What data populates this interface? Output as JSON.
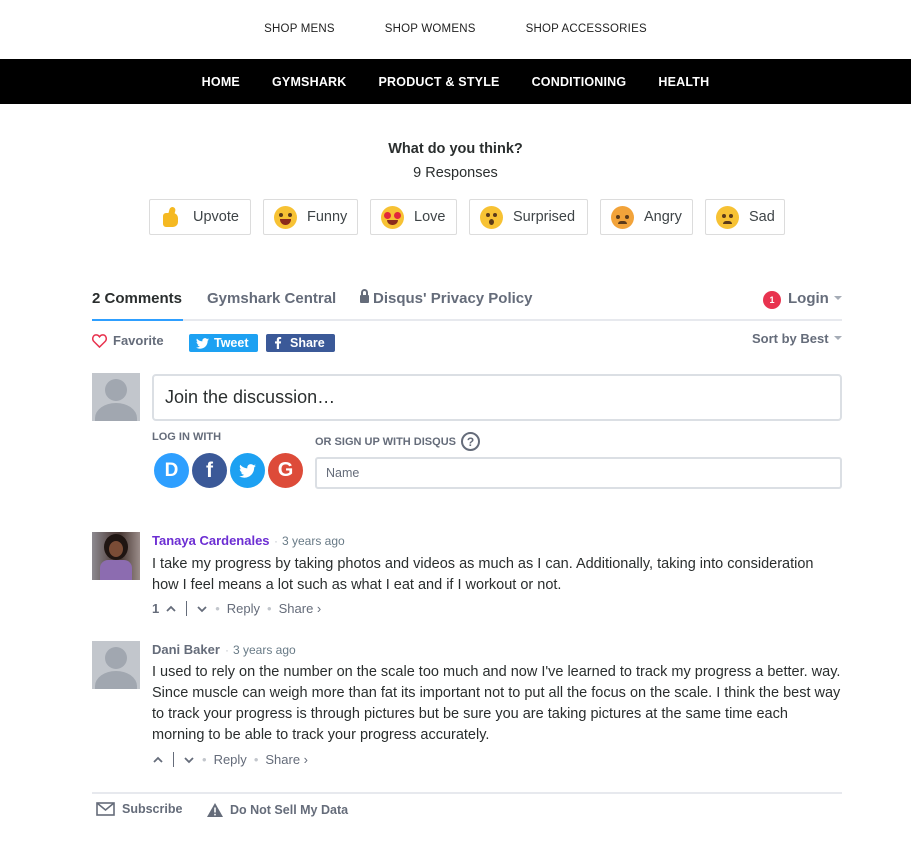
{
  "shop_nav": {
    "items": [
      {
        "label": "SHOP MENS"
      },
      {
        "label": "SHOP WOMENS"
      },
      {
        "label": "SHOP ACCESSORIES"
      }
    ]
  },
  "main_nav": {
    "items": [
      {
        "label": "HOME"
      },
      {
        "label": "GYMSHARK"
      },
      {
        "label": "PRODUCT & STYLE"
      },
      {
        "label": "CONDITIONING"
      },
      {
        "label": "HEALTH"
      }
    ]
  },
  "reactions": {
    "title": "What do you think?",
    "count_label": "9 Responses",
    "items": [
      {
        "label": "Upvote",
        "icon": "thumbs-up-icon"
      },
      {
        "label": "Funny",
        "icon": "laughing-face-icon"
      },
      {
        "label": "Love",
        "icon": "heart-eyes-face-icon"
      },
      {
        "label": "Surprised",
        "icon": "surprised-face-icon"
      },
      {
        "label": "Angry",
        "icon": "angry-face-icon"
      },
      {
        "label": "Sad",
        "icon": "sad-face-icon"
      }
    ]
  },
  "disqus": {
    "tabs": {
      "comments": "2 Comments",
      "community": "Gymshark Central",
      "privacy": "Disqus' Privacy Policy"
    },
    "notification_count": "1",
    "login_label": "Login",
    "favorite_label": "Favorite",
    "tweet_label": "Tweet",
    "share_label": "Share",
    "sort_label": "Sort by Best",
    "join_placeholder": "Join the discussion…",
    "log_in_with": "LOG IN WITH",
    "or_sign_up": "OR SIGN UP WITH DISQUS",
    "help_glyph": "?",
    "name_placeholder": "Name",
    "social_logins": [
      {
        "glyph": "D",
        "color": "#2e9fff",
        "icon": "disqus-icon"
      },
      {
        "glyph": "f",
        "color": "#3b5998",
        "icon": "facebook-icon"
      },
      {
        "glyph": "t",
        "color": "#1da1f2",
        "icon": "twitter-icon"
      },
      {
        "glyph": "G",
        "color": "#dd4b39",
        "icon": "google-icon"
      }
    ],
    "comments": [
      {
        "author": "Tanaya Cardenales",
        "author_color": "#6c2ed3",
        "time": "3 years ago",
        "text": "I take my progress by taking photos and videos as much as I can. Additionally, taking into consideration how I feel means a lot such as what I eat and if I workout or not.",
        "votes": "1",
        "reply": "Reply",
        "share": "Share ›"
      },
      {
        "author": "Dani Baker",
        "author_color": "#656c7a",
        "time": "3 years ago",
        "text": "I used to rely on the number on the scale too much and now I've learned to track my progress a better. way. Since muscle can weigh more than fat its important not to put all the focus on the scale. I think the best way to track your progress is through pictures but be sure you are taking pictures at the same time each morning to be able to track your progress accurately.",
        "votes": "",
        "reply": "Reply",
        "share": "Share ›"
      }
    ],
    "footer": {
      "subscribe": "Subscribe",
      "do_not_sell": "Do Not Sell My Data"
    },
    "colors": {
      "accent": "#2e9fff",
      "twitter": "#1da1f2",
      "facebook": "#3b5998",
      "badge": "#e8334f"
    }
  }
}
